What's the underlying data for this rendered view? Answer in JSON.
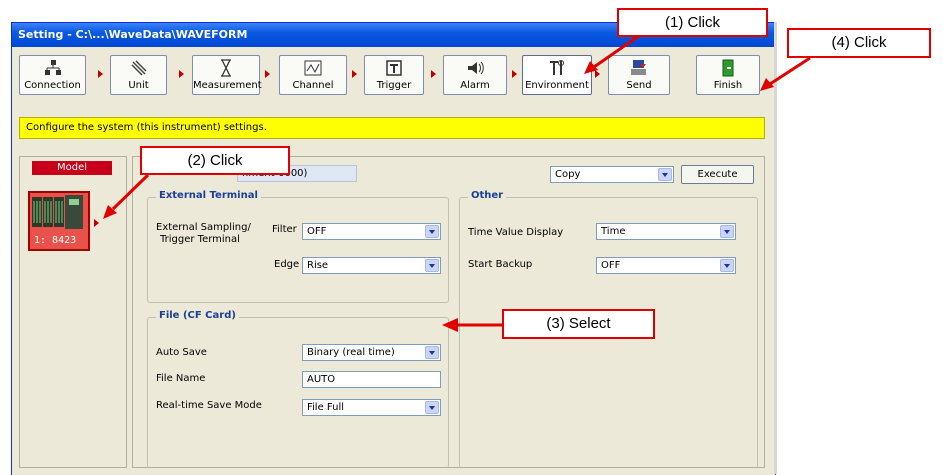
{
  "window": {
    "title": "Setting - C:\\...\\WaveData\\WAVEFORM"
  },
  "toolbar": {
    "buttons": [
      {
        "label": "Connection",
        "icon": "network-icon"
      },
      {
        "label": "Unit",
        "icon": "unit-icon"
      },
      {
        "label": "Measurement",
        "icon": "hourglass-icon"
      },
      {
        "label": "Channel",
        "icon": "waveform-icon"
      },
      {
        "label": "Trigger",
        "icon": "trigger-icon"
      },
      {
        "label": "Alarm",
        "icon": "speaker-icon"
      },
      {
        "label": "Environment",
        "icon": "tools-icon"
      },
      {
        "label": "Send",
        "icon": "send-icon"
      },
      {
        "label": "Finish",
        "icon": "exit-door-icon"
      }
    ]
  },
  "hint": "Configure the system (this instrument) settings.",
  "model": {
    "header": "Model",
    "tile_label": "1: 8423"
  },
  "main": {
    "device_name": "nment-0000)",
    "copy_combo": "Copy",
    "execute_label": "Execute",
    "external_terminal": {
      "title": "External Terminal",
      "sampling_label_1": "External Sampling/",
      "sampling_label_2": "Trigger Terminal",
      "filter_label": "Filter",
      "filter_value": "OFF",
      "edge_label": "Edge",
      "edge_value": "Rise"
    },
    "other": {
      "title": "Other",
      "time_value_label": "Time Value Display",
      "time_value_value": "Time",
      "start_backup_label": "Start Backup",
      "start_backup_value": "OFF"
    },
    "file": {
      "title": "File (CF Card)",
      "auto_save_label": "Auto Save",
      "auto_save_value": "Binary (real time)",
      "file_name_label": "File Name",
      "file_name_value": "AUTO",
      "realtime_label": "Real-time Save Mode",
      "realtime_value": "File Full"
    }
  },
  "callouts": {
    "c1": "(1) Click",
    "c2": "(2) Click",
    "c3": "(3) Select",
    "c4": "(4) Click"
  },
  "colors": {
    "callout": "#e00000",
    "hint_bg": "#ffff00",
    "model_tile": "#e8524a"
  }
}
